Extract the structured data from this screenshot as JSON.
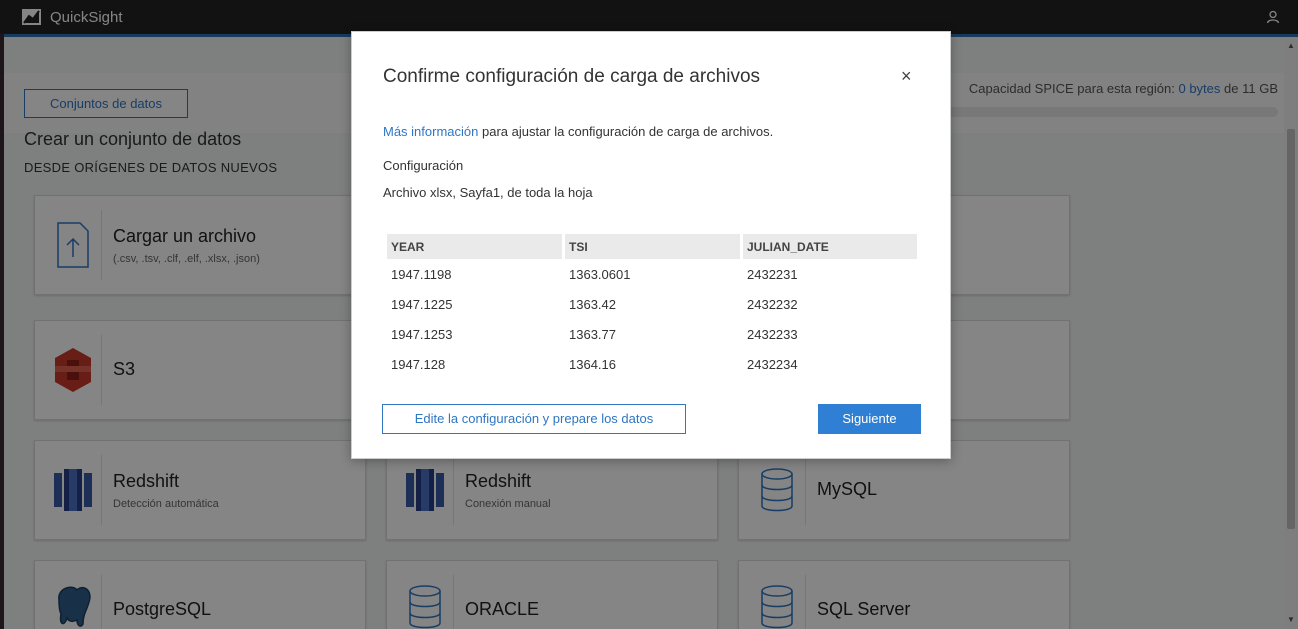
{
  "app": {
    "title": "QuickSight"
  },
  "toolbar": {
    "datasets_button": "Conjuntos de datos"
  },
  "spice": {
    "prefix": "Capacidad SPICE para esta región:",
    "used": "0 bytes",
    "suffix": "de 11 GB"
  },
  "section": {
    "title": "Crear un conjunto de datos",
    "subtitle": "DESDE ORÍGENES DE DATOS NUEVOS"
  },
  "cards": {
    "upload": {
      "name": "Cargar un archivo",
      "desc": "(.csv, .tsv, .clf, .elf, .xlsx, .json)"
    },
    "s3": {
      "name": "S3"
    },
    "redshift_auto": {
      "name": "Redshift",
      "desc": "Detección automática"
    },
    "redshift_manual": {
      "name": "Redshift",
      "desc": "Conexión manual"
    },
    "mysql": {
      "name": "MySQL"
    },
    "postgresql": {
      "name": "PostgreSQL"
    },
    "oracle": {
      "name": "ORACLE"
    },
    "sqlserver": {
      "name": "SQL Server"
    }
  },
  "modal": {
    "title": "Confirme configuración de carga de archivos",
    "close": "×",
    "info_link": "Más información",
    "info_text": " para ajustar la configuración de carga de archivos.",
    "config_label": "Configuración",
    "config_value": "Archivo xlsx, Sayfa1, de toda la hoja",
    "table": {
      "headers": [
        "YEAR",
        "TSI",
        "JULIAN_DATE"
      ],
      "rows": [
        [
          "1947.1198",
          "1363.0601",
          "2432231"
        ],
        [
          "1947.1225",
          "1363.42",
          "2432232"
        ],
        [
          "1947.1253",
          "1363.77",
          "2432233"
        ],
        [
          "1947.128",
          "1364.16",
          "2432234"
        ]
      ]
    },
    "edit_button": "Edite la configuración y prepare los datos",
    "next_button": "Siguiente"
  },
  "colors": {
    "accent": "#2f76c3",
    "primary_button": "#2f80d4",
    "appbar": "#232323"
  },
  "icons": [
    "quicksight-logo-icon",
    "user-icon",
    "upload-file-icon",
    "s3-icon",
    "redshift-icon",
    "database-icon",
    "postgresql-icon",
    "close-icon"
  ]
}
